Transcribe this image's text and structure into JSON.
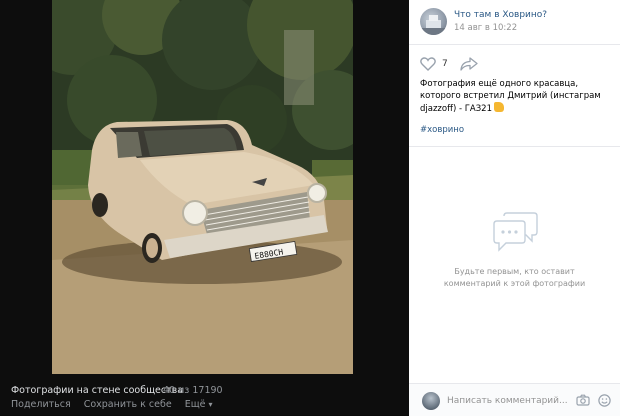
{
  "viewer": {
    "photo_alt": "ГАЗ-21 Волга",
    "license_plate": "Е880СН",
    "plate_region": "68",
    "album_title": "Фотографии на стене сообщества",
    "photo_counter": "40 из 17190",
    "actions": {
      "share": "Поделиться",
      "save": "Сохранить к себе",
      "more": "Ещё"
    }
  },
  "panel": {
    "community_name": "Что там в Ховрино?",
    "date": "14 авг в 10:22",
    "likes": "7",
    "caption": "Фотография ещё одного красавца, которого встретил Дмитрий (инстаграм djazzoff) - ГАЗ21",
    "hashtag": "#ховрино",
    "empty_comments": {
      "line1": "Будьте первым, кто оставит",
      "line2": "комментарий к этой фотографии"
    },
    "comment_placeholder": "Написать комментарий..."
  },
  "icons": {
    "like": "heart-icon",
    "share": "share-arrow-icon",
    "comments": "comments-bubbles-icon",
    "attach": "camera-icon",
    "emoji": "smile-icon",
    "caption_emoji": "hand-emoji"
  },
  "colors": {
    "link": "#2a5885",
    "secondary_text": "#939393",
    "viewer_bg": "#0d0d0d",
    "panel_bg": "#ffffff"
  }
}
